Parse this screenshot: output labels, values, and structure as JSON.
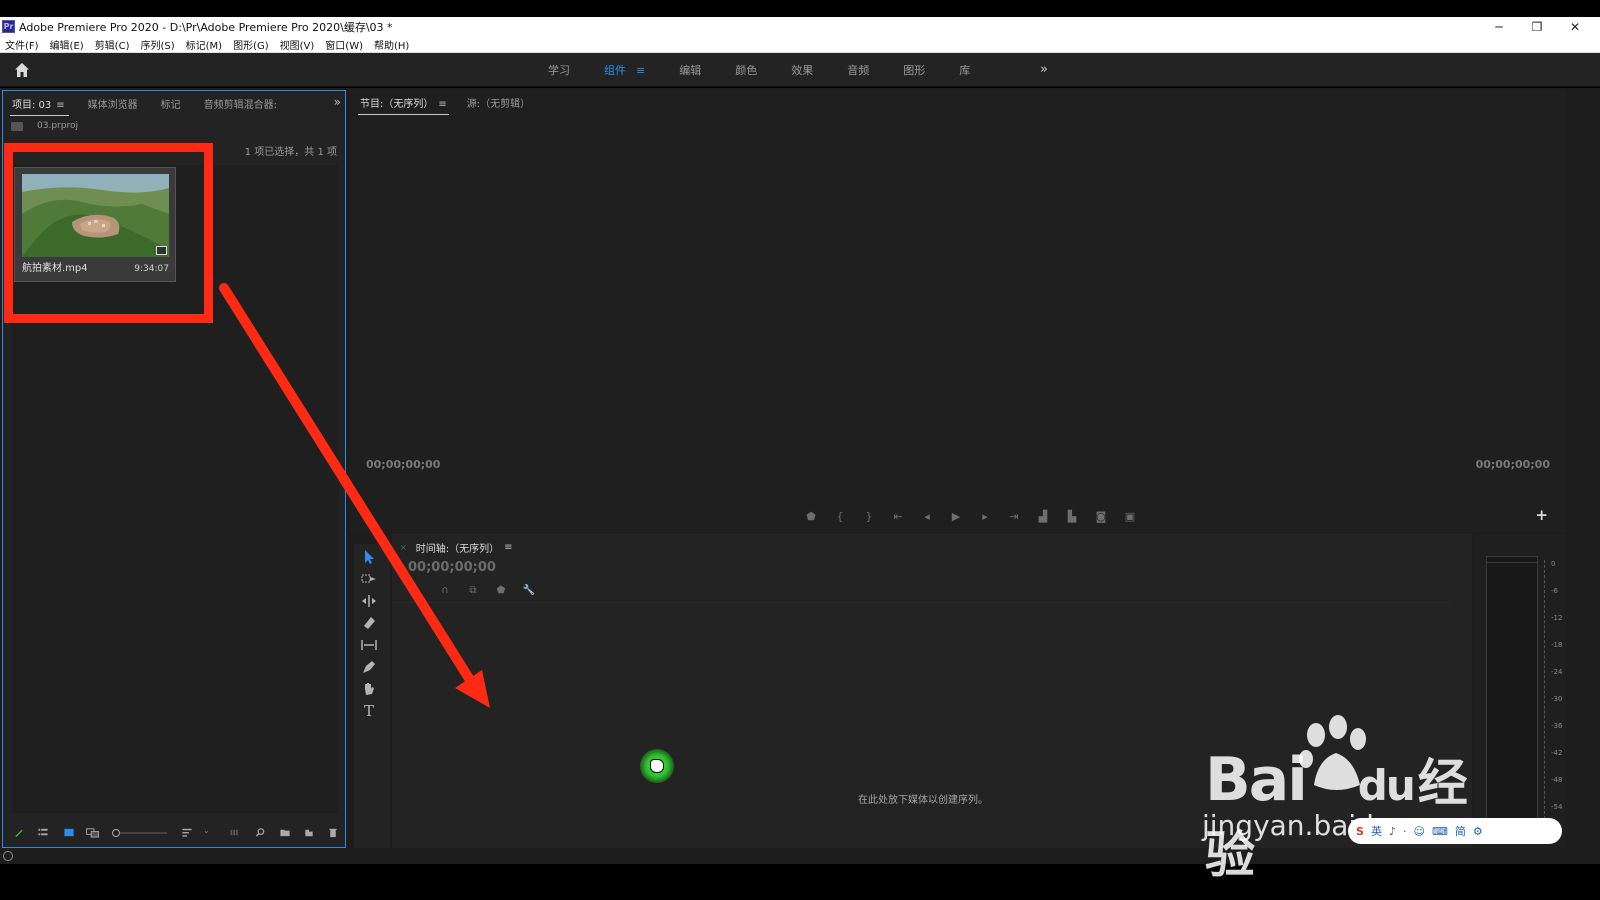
{
  "window": {
    "title": "Adobe Premiere Pro 2020 - D:\\Pr\\Adobe Premiere Pro 2020\\缓存\\03 *",
    "logo": "Pr",
    "controls": [
      "minimize-icon",
      "restore-icon",
      "close-icon"
    ]
  },
  "menu": [
    "文件(F)",
    "编辑(E)",
    "剪辑(C)",
    "序列(S)",
    "标记(M)",
    "图形(G)",
    "视图(V)",
    "窗口(W)",
    "帮助(H)"
  ],
  "workspaces": {
    "tabs": [
      "学习",
      "组件",
      "编辑",
      "颜色",
      "效果",
      "音频",
      "图形",
      "库"
    ],
    "active": "组件",
    "more": "»"
  },
  "project_panel": {
    "tabs": [
      "项目: 03",
      "媒体浏览器",
      "标记",
      "音频剪辑混合器:"
    ],
    "overflow": "»",
    "file": "03.prproj",
    "selection_count": "1 项已选择，共 1 项",
    "item": {
      "name": "航拍素材.mp4",
      "duration": "9:34:07"
    }
  },
  "monitor": {
    "tabs": [
      "节目:（无序列）",
      "源:（无剪辑）"
    ],
    "timecode_left": "00;00;00;00",
    "timecode_right": "00;00;00;00"
  },
  "timeline": {
    "tab": "时间轴:（无序列）",
    "timecode": "00;00;00;00",
    "drop_hint": "在此处放下媒体以创建序列。"
  },
  "audio_meter": {
    "labels": [
      "0",
      "-6",
      "-12",
      "-18",
      "-24",
      "-30",
      "-36",
      "-42",
      "-48",
      "-54"
    ]
  },
  "watermark": {
    "brand": "Bai",
    "brand_suffix": "du",
    "product": "经验",
    "url": "jingyan.baidu.com"
  },
  "ime": {
    "items": [
      "S",
      "英",
      "♪",
      "·",
      "☺",
      "⌨",
      "简",
      "⚙"
    ]
  },
  "colors": {
    "accent": "#2d8ceb",
    "annotation_red": "#ff2a14",
    "panel_bg": "#232323"
  }
}
